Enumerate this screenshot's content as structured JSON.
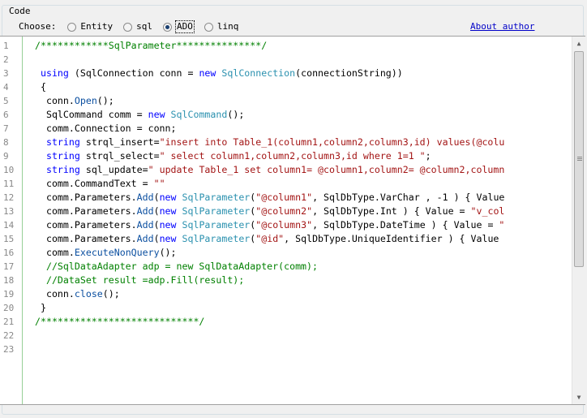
{
  "group": {
    "title": "Code"
  },
  "choose": {
    "label": "Choose:",
    "options": [
      {
        "label": "Entity",
        "checked": false
      },
      {
        "label": "sql",
        "checked": false
      },
      {
        "label": "ADO",
        "checked": true
      },
      {
        "label": "linq",
        "checked": false
      }
    ]
  },
  "about_link": "About author",
  "colors": {
    "comment": "#008000",
    "keyword": "#0000ff",
    "type": "#2b91af",
    "method": "#0b4fa0",
    "string": "#a31515",
    "link": "#0000c8"
  },
  "editor": {
    "line_numbers": [
      "1",
      "2",
      "3",
      "4",
      "5",
      "6",
      "7",
      "8",
      "9",
      "10",
      "11",
      "12",
      "13",
      "14",
      "15",
      "16",
      "17",
      "18",
      "19",
      "20",
      "21",
      "22",
      "23"
    ],
    "lines": [
      [
        [
          "comment",
          "/************SqlParameter***************/"
        ]
      ],
      [],
      [
        [
          "plain",
          " "
        ],
        [
          "keyword",
          "using"
        ],
        [
          "plain",
          " (SqlConnection conn = "
        ],
        [
          "keyword",
          "new"
        ],
        [
          "plain",
          " "
        ],
        [
          "type",
          "SqlConnection"
        ],
        [
          "plain",
          "(connectionString))"
        ]
      ],
      [
        [
          "plain",
          " {"
        ]
      ],
      [
        [
          "plain",
          "  conn."
        ],
        [
          "method",
          "Open"
        ],
        [
          "plain",
          "();"
        ]
      ],
      [
        [
          "plain",
          "  SqlCommand comm = "
        ],
        [
          "keyword",
          "new"
        ],
        [
          "plain",
          " "
        ],
        [
          "type",
          "SqlCommand"
        ],
        [
          "plain",
          "();"
        ]
      ],
      [
        [
          "plain",
          "  comm.Connection = conn;"
        ]
      ],
      [
        [
          "plain",
          "  "
        ],
        [
          "keyword",
          "string"
        ],
        [
          "plain",
          " strql_insert="
        ],
        [
          "string",
          "\"insert into Table_1(column1,column2,column3,id) values(@colu"
        ]
      ],
      [
        [
          "plain",
          "  "
        ],
        [
          "keyword",
          "string"
        ],
        [
          "plain",
          " strql_select="
        ],
        [
          "string",
          "\" select column1,column2,column3,id where 1=1 \""
        ],
        [
          "plain",
          ";"
        ]
      ],
      [
        [
          "plain",
          "  "
        ],
        [
          "keyword",
          "string"
        ],
        [
          "plain",
          " sql_update="
        ],
        [
          "string",
          "\" update Table_1 set column1= @column1,column2= @column2,column"
        ]
      ],
      [
        [
          "plain",
          "  comm.CommandText = "
        ],
        [
          "string",
          "\"\""
        ]
      ],
      [
        [
          "plain",
          "  comm.Parameters."
        ],
        [
          "method",
          "Add"
        ],
        [
          "plain",
          "("
        ],
        [
          "keyword",
          "new"
        ],
        [
          "plain",
          " "
        ],
        [
          "type",
          "SqlParameter"
        ],
        [
          "plain",
          "("
        ],
        [
          "string",
          "\"@column1\""
        ],
        [
          "plain",
          ", SqlDbType.VarChar , -1 ) { Value"
        ]
      ],
      [
        [
          "plain",
          "  comm.Parameters."
        ],
        [
          "method",
          "Add"
        ],
        [
          "plain",
          "("
        ],
        [
          "keyword",
          "new"
        ],
        [
          "plain",
          " "
        ],
        [
          "type",
          "SqlParameter"
        ],
        [
          "plain",
          "("
        ],
        [
          "string",
          "\"@column2\""
        ],
        [
          "plain",
          ", SqlDbType.Int ) { Value = "
        ],
        [
          "string",
          "\"v_col"
        ]
      ],
      [
        [
          "plain",
          "  comm.Parameters."
        ],
        [
          "method",
          "Add"
        ],
        [
          "plain",
          "("
        ],
        [
          "keyword",
          "new"
        ],
        [
          "plain",
          " "
        ],
        [
          "type",
          "SqlParameter"
        ],
        [
          "plain",
          "("
        ],
        [
          "string",
          "\"@column3\""
        ],
        [
          "plain",
          ", SqlDbType.DateTime ) { Value = "
        ],
        [
          "string",
          "\""
        ]
      ],
      [
        [
          "plain",
          "  comm.Parameters."
        ],
        [
          "method",
          "Add"
        ],
        [
          "plain",
          "("
        ],
        [
          "keyword",
          "new"
        ],
        [
          "plain",
          " "
        ],
        [
          "type",
          "SqlParameter"
        ],
        [
          "plain",
          "("
        ],
        [
          "string",
          "\"@id\""
        ],
        [
          "plain",
          ", SqlDbType.UniqueIdentifier ) { Value"
        ]
      ],
      [
        [
          "plain",
          "  comm."
        ],
        [
          "method",
          "ExecuteNonQuery"
        ],
        [
          "plain",
          "();"
        ]
      ],
      [
        [
          "comment",
          "  //SqlDataAdapter adp = new SqlDataAdapter(comm);"
        ]
      ],
      [
        [
          "comment",
          "  //DataSet result =adp.Fill(result);"
        ]
      ],
      [
        [
          "plain",
          "  conn."
        ],
        [
          "method",
          "close"
        ],
        [
          "plain",
          "();"
        ]
      ],
      [
        [
          "plain",
          " }"
        ]
      ],
      [
        [
          "comment",
          "/****************************/"
        ]
      ],
      [],
      []
    ]
  }
}
